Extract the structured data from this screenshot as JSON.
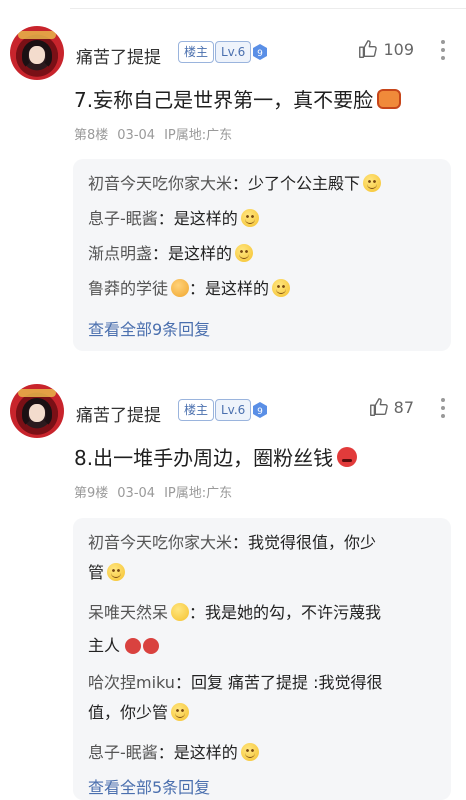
{
  "posts": [
    {
      "username": "痛苦了提提",
      "owner_badge": "楼主",
      "level": "Lv.6",
      "likes": "109",
      "content": "7.妄称自己是世界第一，真不要脸",
      "content_emoji": "mask-emoji",
      "floor": "第8楼",
      "date": "03-04",
      "ip": "IP属地:广东",
      "replies": [
        {
          "name": "初音今天吃你家大米",
          "text": "少了个公主殿下",
          "emoji": "smile-emoji"
        },
        {
          "name": "息子-眠酱",
          "text": "是这样的",
          "emoji": "smile-emoji"
        },
        {
          "name": "渐点明盏",
          "text": "是这样的",
          "emoji": "smile-emoji"
        },
        {
          "name": "鲁莽的学徒",
          "text": "是这样的",
          "emoji": "smile-emoji"
        }
      ],
      "view_all": "查看全部9条回复"
    },
    {
      "username": "痛苦了提提",
      "owner_badge": "楼主",
      "level": "Lv.6",
      "likes": "87",
      "content": "8.出一堆手办周边，圈粉丝钱",
      "content_emoji": "angry-emoji",
      "floor": "第9楼",
      "date": "03-04",
      "ip": "IP属地:广东",
      "replies": [
        {
          "name": "初音今天吃你家大米",
          "text_l1": "我觉得很值，你少",
          "text_l2": "管"
        },
        {
          "name": "呆唯天然呆",
          "text_l1": "我是她的勾，不许污蔑我",
          "text_l2": "主人"
        },
        {
          "name": "哈次捏miku",
          "text_l1": "回复 痛苦了提提 :我觉得很",
          "text_l2": "值，你少管"
        },
        {
          "name": "息子-眠酱",
          "text_l1": "是这样的"
        }
      ],
      "view_all": "查看全部5条回复"
    }
  ],
  "colors": {
    "link": "#4a6fae",
    "reply_bg": "#f5f6f8",
    "meta": "#9a9a9a"
  }
}
